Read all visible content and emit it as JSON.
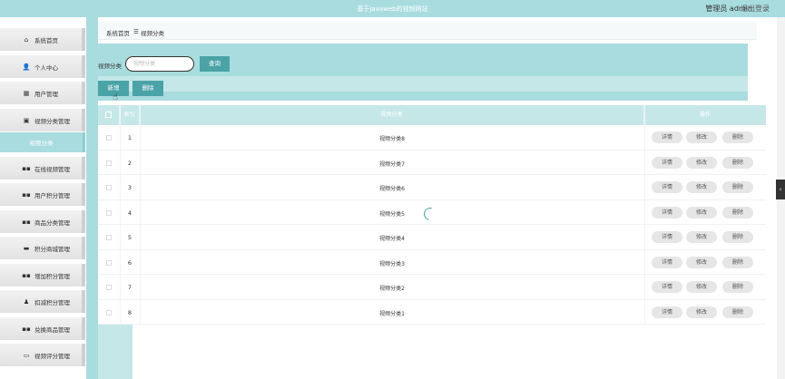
{
  "header": {
    "title": "基于Javaweb的视频网站",
    "user": "管理员 admin",
    "logout": "退出登录"
  },
  "sidebar": {
    "items": [
      {
        "label": "系统首页",
        "icon": "home-icon",
        "glyph": "⌂"
      },
      {
        "label": "个人中心",
        "icon": "user-icon",
        "glyph": "👤"
      },
      {
        "label": "用户管理",
        "icon": "grid-icon",
        "glyph": "▦"
      },
      {
        "label": "视频分类管理",
        "icon": "clipboard-icon",
        "glyph": "▣"
      },
      {
        "label": "视频分类",
        "icon": "",
        "glyph": ""
      },
      {
        "label": "在线视频管理",
        "icon": "apps-icon",
        "glyph": "▪▪"
      },
      {
        "label": "用户积分管理",
        "icon": "apps-icon",
        "glyph": "▪▪"
      },
      {
        "label": "商品分类管理",
        "icon": "apps-icon",
        "glyph": "▪▪"
      },
      {
        "label": "积分商城管理",
        "icon": "briefcase-icon",
        "glyph": "▬"
      },
      {
        "label": "增加积分管理",
        "icon": "apps-icon",
        "glyph": "▪▪"
      },
      {
        "label": "扣减积分管理",
        "icon": "person-icon",
        "glyph": "♟"
      },
      {
        "label": "兑换商品管理",
        "icon": "apps-icon",
        "glyph": "▪▪"
      },
      {
        "label": "视频评分管理",
        "icon": "monitor-icon",
        "glyph": "▭"
      }
    ]
  },
  "breadcrumb": {
    "home": "系统首页",
    "sep": "☰",
    "current": "视频分类"
  },
  "search": {
    "label": "视频分类",
    "placeholder": "视频分类",
    "value": "",
    "query_button": "查询"
  },
  "actions": {
    "add": "新增",
    "delete": "删除"
  },
  "table": {
    "headers": {
      "index": "索引",
      "name": "视频分类",
      "ops": "操作"
    },
    "row_actions": {
      "detail": "详情",
      "edit": "修改",
      "delete": "删除"
    },
    "rows": [
      {
        "index": "1",
        "name": "视频分类8"
      },
      {
        "index": "2",
        "name": "视频分类7"
      },
      {
        "index": "3",
        "name": "视频分类6"
      },
      {
        "index": "4",
        "name": "视频分类5"
      },
      {
        "index": "5",
        "name": "视频分类4"
      },
      {
        "index": "6",
        "name": "视频分类3"
      },
      {
        "index": "7",
        "name": "视频分类2"
      },
      {
        "index": "8",
        "name": "视频分类1"
      }
    ]
  },
  "colors": {
    "accent": "#a9dcdf",
    "accent_light": "#c6e7e8",
    "button": "#4aa3a6"
  }
}
